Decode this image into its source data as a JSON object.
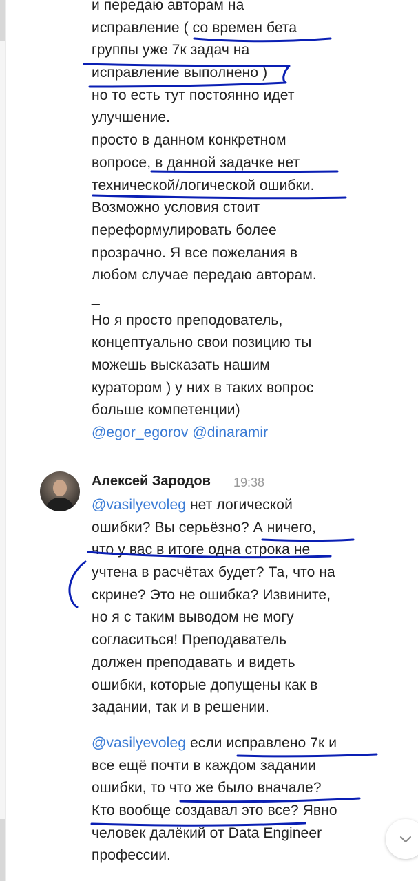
{
  "message1": {
    "lines": [
      "и передаю авторам на",
      "исправление ( со времен бета",
      "группы уже 7к задач на",
      "исправление выполнено )",
      "но то есть тут постоянно идет",
      "улучшение.",
      "просто в данном конкретном",
      "вопросе, в данной задачке нет",
      "технической/логической ошибки.",
      "Возможно условия стоит",
      "переформулировать более",
      "прозрачно. Я все пожелания в",
      "любом случае передаю авторам.",
      "_",
      "Но я просто преподователь,",
      "концептуально свои позицию ты",
      "можешь высказать нашим",
      "куратором ) у них в таких вопрос",
      "больше компетенции)"
    ],
    "mention1": "@egor_egorov",
    "mention2": "@dinaramir"
  },
  "message2": {
    "author": "Алексей Зародов",
    "time": "19:38",
    "para1": {
      "mention": "@vasilyevoleg",
      "first_line_rest": " нет логической",
      "lines": [
        "ошибки? Вы серьёзно? А ничего,",
        "что у вас в итоге одна строка не",
        "учтена в расчётах будет? Та, что на",
        "скрине? Это не ошибка? Извините,",
        "но я с таким выводом не могу",
        "согласиться! Преподаватель",
        "должен преподавать и видеть",
        "ошибки, которые допущены как в",
        "задании, так и в решении."
      ]
    },
    "para2": {
      "mention": "@vasilyevoleg",
      "first_line_rest": " если исправлено 7к и",
      "lines": [
        "все ещё почти в каждом задании",
        "ошибки, то что же было вначале?",
        "Кто вообще создавал это все? Явно",
        "человек далёкий от Data Engineer",
        "профессии."
      ]
    }
  },
  "colors": {
    "mention": "#3a7bd5",
    "annotation_ink": "#0a1fb4",
    "text": "#222222",
    "time": "#999999"
  },
  "icons": {
    "scroll_down": "chevron-down-icon"
  }
}
